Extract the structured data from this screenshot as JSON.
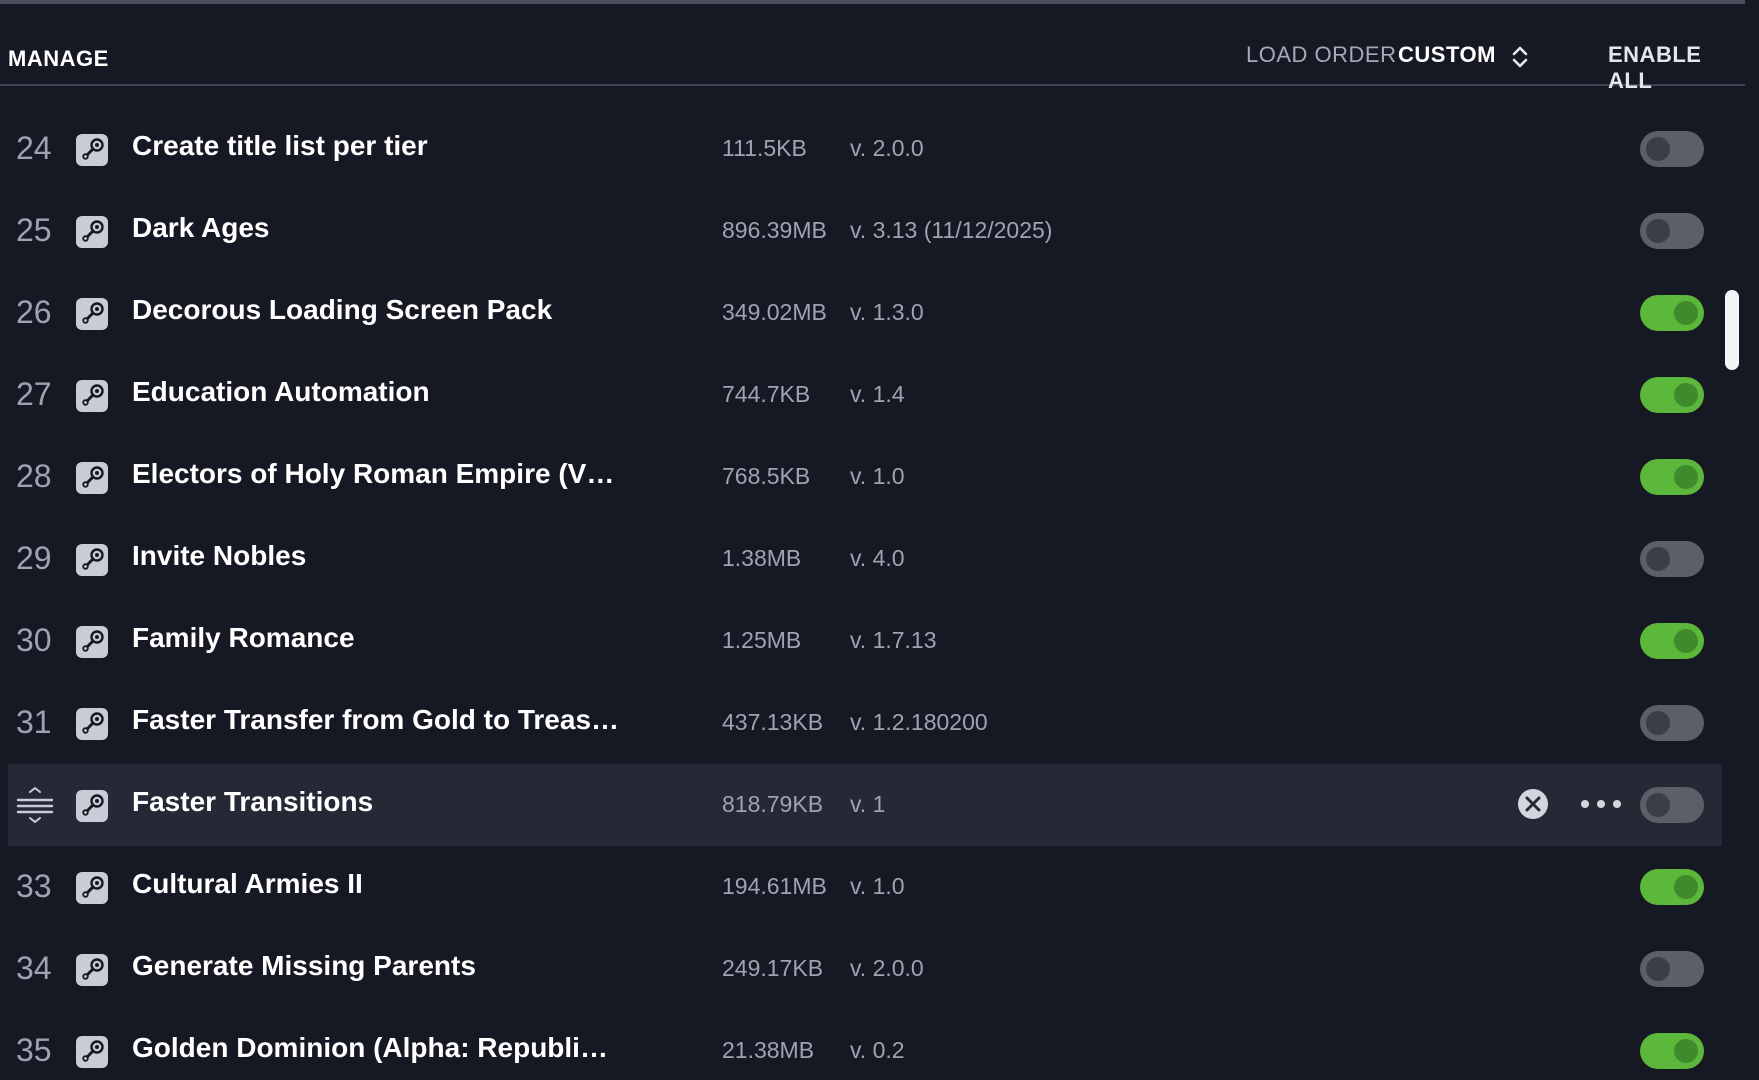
{
  "header": {
    "title": "MANAGE",
    "load_order_label": "LOAD ORDER",
    "load_order_value": "CUSTOM",
    "enable_all_label": "ENABLE ALL"
  },
  "icons": {
    "source": "steam-icon",
    "sort": "chevron-up-down-icon",
    "drag": "drag-handle-icon",
    "remove": "remove-circle-icon",
    "more": "more-options-icon"
  },
  "colors": {
    "background": "#161824",
    "row_hover": "#252835",
    "toggle_on": "#5cb83a",
    "toggle_off": "#5c5e68",
    "muted_text": "#9fa3b0"
  },
  "mods": [
    {
      "index": "24",
      "name": "Create title list per tier",
      "size": "111.5KB",
      "version": "v. 2.0.0",
      "enabled": false
    },
    {
      "index": "25",
      "name": "Dark Ages",
      "size": "896.39MB",
      "version": "v. 3.13 (11/12/2025)",
      "enabled": false
    },
    {
      "index": "26",
      "name": "Decorous Loading Screen Pack",
      "size": "349.02MB",
      "version": "v. 1.3.0",
      "enabled": true
    },
    {
      "index": "27",
      "name": "Education Automation",
      "size": "744.7KB",
      "version": "v. 1.4",
      "enabled": true
    },
    {
      "index": "28",
      "name": "Electors of Holy Roman Empire (V…",
      "size": "768.5KB",
      "version": "v. 1.0",
      "enabled": true
    },
    {
      "index": "29",
      "name": "Invite Nobles",
      "size": "1.38MB",
      "version": "v. 4.0",
      "enabled": false
    },
    {
      "index": "30",
      "name": "Family Romance",
      "size": "1.25MB",
      "version": "v. 1.7.13",
      "enabled": true
    },
    {
      "index": "31",
      "name": "Faster Transfer from Gold to Treas…",
      "size": "437.13KB",
      "version": "v. 1.2.180200",
      "enabled": false
    },
    {
      "index": "",
      "name": "Faster Transitions",
      "size": "818.79KB",
      "version": "v. 1",
      "enabled": false,
      "hovered": true
    },
    {
      "index": "33",
      "name": "Cultural Armies II",
      "size": "194.61MB",
      "version": "v. 1.0",
      "enabled": true
    },
    {
      "index": "34",
      "name": "Generate Missing Parents",
      "size": "249.17KB",
      "version": "v. 2.0.0",
      "enabled": false
    },
    {
      "index": "35",
      "name": "Golden Dominion (Alpha: Republi…",
      "size": "21.38MB",
      "version": "v. 0.2",
      "enabled": true
    }
  ]
}
